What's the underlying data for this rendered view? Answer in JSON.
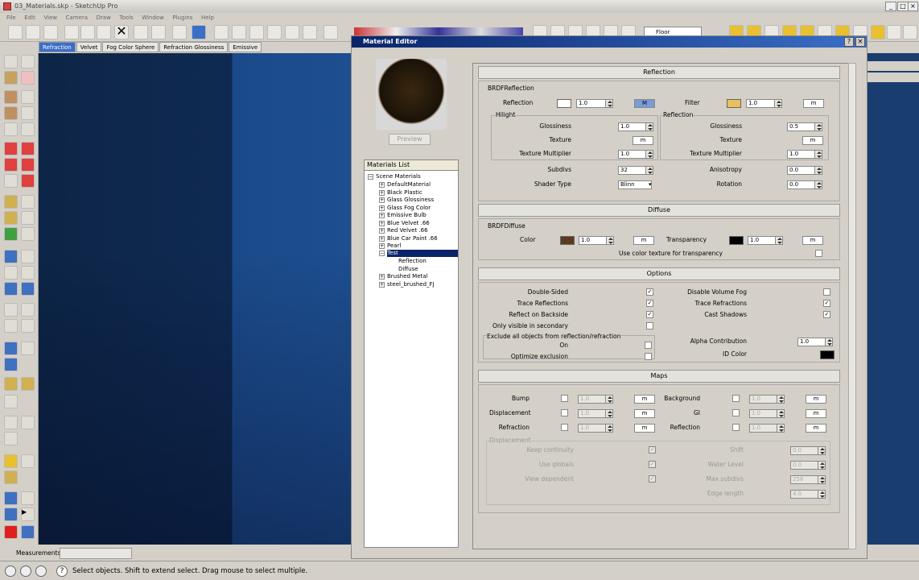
{
  "window": {
    "title": "03_Materials.skp - SketchUp Pro"
  },
  "menu": [
    "File",
    "Edit",
    "View",
    "Camera",
    "Draw",
    "Tools",
    "Window",
    "Plugins",
    "Help"
  ],
  "toolbar": {
    "layer_value": "Floor"
  },
  "tabs": [
    "Refraction",
    "Velvet",
    "Fog Color Sphere",
    "Refraction Glossiness",
    "Emissive"
  ],
  "editor": {
    "title": "Material Editor",
    "preview_button": "Preview",
    "materials_list_header": "Materials List",
    "tree": {
      "root": "Scene Materials",
      "items": [
        "DefaultMaterial",
        "Black Plastic",
        "Glass Glossiness",
        "Glass Fog Color",
        "Emissive Bulb",
        "Blue Velvet .66",
        "Red Velvet .66",
        "Blue Car Paint .66",
        "Pearl",
        "Test"
      ],
      "children": [
        "Reflection",
        "Diffuse"
      ],
      "after": [
        "Brushed Metal",
        "steel_brushed_FJ"
      ]
    }
  },
  "reflection": {
    "header": "Reflection",
    "group": "BRDFReflection",
    "reflection_label": "Reflection",
    "reflection_value": "1.0",
    "reflection_m": "M",
    "filter_label": "Filter",
    "filter_value": "1.0",
    "filter_m": "m",
    "hilight": "Hilight",
    "h_glossiness": "Glossiness",
    "h_glossiness_value": "1.0",
    "h_texture": "Texture",
    "h_texture_m": "m",
    "h_multiplier": "Texture Multiplier",
    "h_multiplier_value": "1.0",
    "refl_group": "Reflection",
    "r_glossiness": "Glossiness",
    "r_glossiness_value": "0.5",
    "r_texture": "Texture",
    "r_texture_m": "m",
    "r_multiplier": "Texture Multiplier",
    "r_multiplier_value": "1.0",
    "subdivs": "Subdivs",
    "subdivs_value": "32",
    "anisotropy": "Anisotropy",
    "anisotropy_value": "0.0",
    "shader_type": "Shader Type",
    "shader_value": "Blinn",
    "rotation": "Rotation",
    "rotation_value": "0.0",
    "filter_color": "#e8c060",
    "reflection_color": "#ffffff"
  },
  "diffuse": {
    "header": "Diffuse",
    "group": "BRDFDiffuse",
    "color_label": "Color",
    "color_value": "1.0",
    "color_m": "m",
    "transparency_label": "Transparency",
    "transparency_value": "1.0",
    "transparency_m": "m",
    "use_color_texture": "Use color texture for transparency",
    "color_swatch": "#5a3a20",
    "transparency_swatch": "#000000"
  },
  "options": {
    "header": "Options",
    "double_sided": "Double-Sided",
    "trace_reflections": "Trace Reflections",
    "reflect_backside": "Reflect on Backside",
    "only_visible": "Only visible in secondary",
    "exclude_group": "Exclude all objects from reflection/refraction",
    "on": "On",
    "optimize": "Optimize exclusion",
    "disable_fog": "Disable Volume Fog",
    "trace_refractions": "Trace Refractions",
    "cast_shadows": "Cast Shadows",
    "alpha": "Alpha Contribution",
    "alpha_value": "1.0",
    "id_color": "ID Color",
    "check": "✓"
  },
  "maps": {
    "header": "Maps",
    "bump": "Bump",
    "displacement": "Displacement",
    "refraction": "Refraction",
    "background": "Background",
    "gi": "GI",
    "reflection": "Reflection",
    "value": "1.0",
    "m": "m",
    "disp_group": "Displacement",
    "keep_continuity": "Keep continuity",
    "use_globals": "Use globals",
    "view_dependent": "View dependent",
    "shift": "Shift",
    "shift_value": "0.0",
    "water_level": "Water Level",
    "water_value": "0.0",
    "max_subdivs": "Max subdivs",
    "max_subdivs_value": "256",
    "edge_length": "Edge length",
    "edge_value": "4.0"
  },
  "status": {
    "measurements": "Measurements",
    "hint": "Select objects. Shift to extend select. Drag mouse to select multiple."
  }
}
